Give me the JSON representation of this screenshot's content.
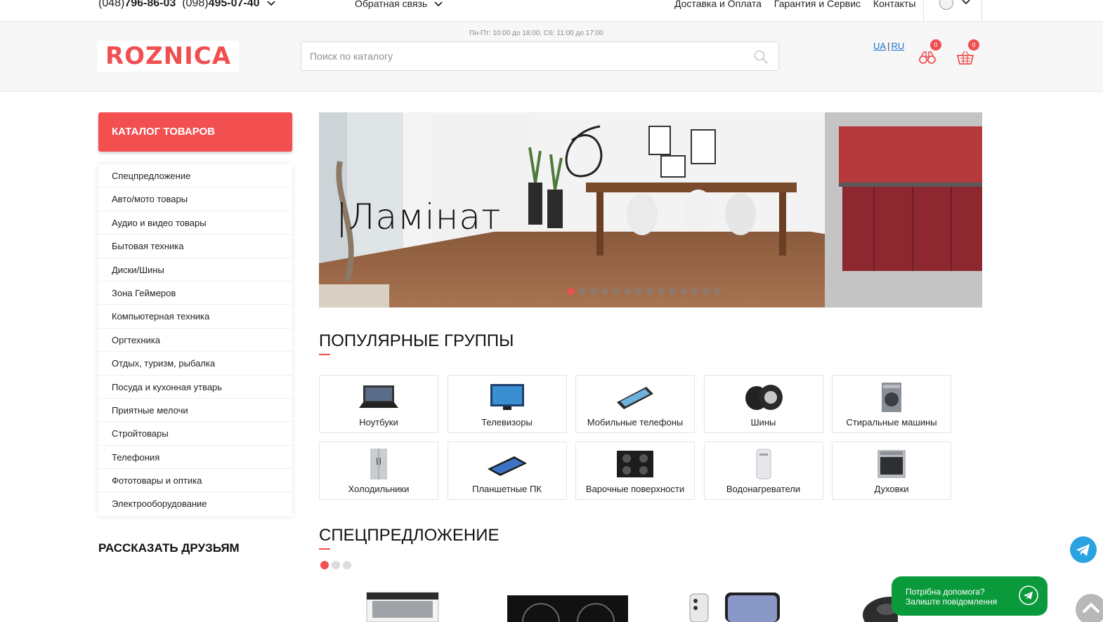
{
  "topbar": {
    "phone1_prefix": "(048)",
    "phone1_number": "796-86-03",
    "phone2_prefix": "(098)",
    "phone2_number": "495-07-40",
    "feedback": "Обратная связь",
    "nav": [
      "Доставка и Оплата",
      "Гарантия и Сервис",
      "Контакты"
    ]
  },
  "header": {
    "logo": "ROZNICA",
    "hours": "Пн-Пт: 10:00 до 18:00, Сб: 11:00 до 17:00",
    "search_placeholder": "Поиск по каталогу",
    "lang_ua": "UA",
    "lang_sep": "|",
    "lang_ru": "RU",
    "compare_count": "0",
    "cart_count": "0"
  },
  "sidebar": {
    "catalog_label": "КАТАЛОГ ТОВАРОВ",
    "items": [
      "Спецпредложение",
      "Авто/мото товары",
      "Аудио и видео товары",
      "Бытовая техника",
      "Диски/Шины",
      "Зона Геймеров",
      "Компьютерная техника",
      "Оргтехника",
      "Отдых, туризм, рыбалка",
      "Посуда и кухонная утварь",
      "Приятные мелочи",
      "Стройтовары",
      "Телефония",
      "Фототовары и оптика",
      "Электрооборудование"
    ],
    "share_title": "РАССКАЗАТЬ ДРУЗЬЯМ"
  },
  "banner": {
    "title": "|Ламінат",
    "slides": 14,
    "active_slide": 1
  },
  "popular": {
    "title": "ПОПУЛЯРНЫЕ ГРУППЫ",
    "groups": [
      {
        "label": "Ноутбуки",
        "icon": "laptop-icon"
      },
      {
        "label": "Телевизоры",
        "icon": "tv-icon"
      },
      {
        "label": "Мобильные телефоны",
        "icon": "phone-icon"
      },
      {
        "label": "Шины",
        "icon": "tires-icon"
      },
      {
        "label": "Стиральные машины",
        "icon": "washing-machine-icon"
      },
      {
        "label": "Холодильники",
        "icon": "fridge-icon"
      },
      {
        "label": "Планшетные ПК",
        "icon": "tablet-icon"
      },
      {
        "label": "Варочные поверхности",
        "icon": "cooktop-icon"
      },
      {
        "label": "Водонагреватели",
        "icon": "water-heater-icon"
      },
      {
        "label": "Духовки",
        "icon": "oven-icon"
      }
    ]
  },
  "special": {
    "title": "СПЕЦПРЕДЛОЖЕНИЕ",
    "pages": 3,
    "active_page": 1
  },
  "help_widget": {
    "line1": "Потрібна допомога?",
    "line2": "Залиште повідомлення"
  },
  "colors": {
    "accent": "#f04f51",
    "link": "#1a6fd1",
    "help_green": "#0b9a3b",
    "telegram": "#2aa3e0"
  }
}
